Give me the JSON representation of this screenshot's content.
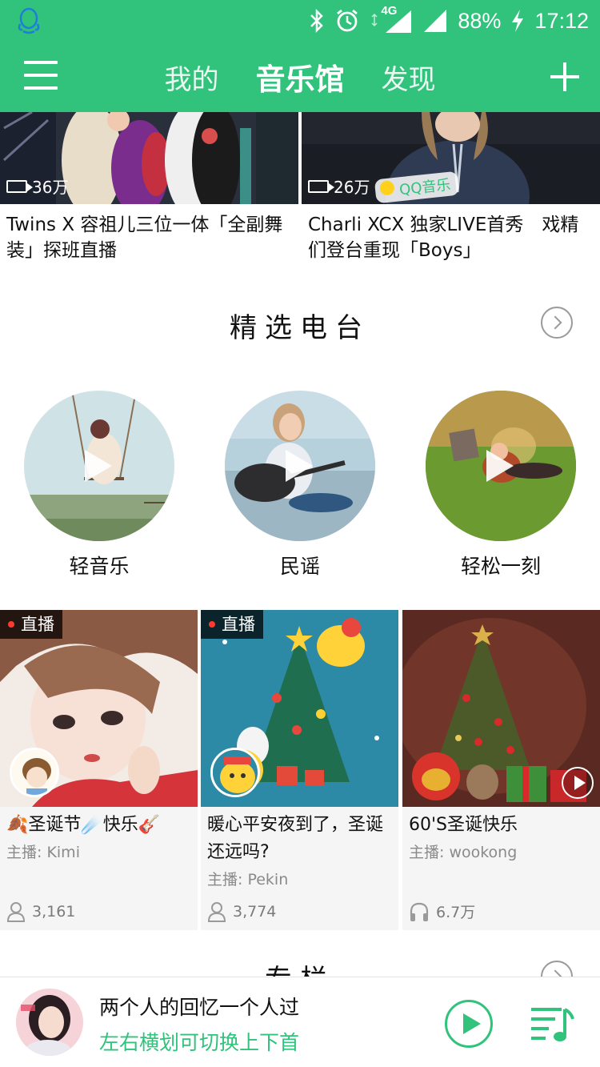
{
  "status_bar": {
    "battery": "88%",
    "time": "17:12",
    "network": "4G"
  },
  "nav": {
    "tabs": [
      {
        "label": "我的",
        "active": false
      },
      {
        "label": "音乐馆",
        "active": true
      },
      {
        "label": "发现",
        "active": false
      }
    ]
  },
  "videos": [
    {
      "views": "36万",
      "title": "Twins X 容祖儿三位一体「全副舞装」探班直播"
    },
    {
      "views": "26万",
      "title": "Charli XCX 独家LIVE首秀　戏精们登台重现「Boys」",
      "watermark": "QQ音乐"
    }
  ],
  "radio_section": {
    "title": "精选电台",
    "stations": [
      {
        "label": "轻音乐"
      },
      {
        "label": "民谣"
      },
      {
        "label": "轻松一刻"
      }
    ]
  },
  "live_cards": [
    {
      "badge": "直播",
      "title": "🍂圣诞节☄️快乐🎸",
      "host": "主播: Kimi",
      "stat": "3,161",
      "stat_icon": "user-icon"
    },
    {
      "badge": "直播",
      "title": "暖心平安夜到了，圣诞还远吗?",
      "host": "主播: Pekin",
      "stat": "3,774",
      "stat_icon": "user-icon"
    },
    {
      "badge": "",
      "title": "60'S圣诞快乐",
      "host": "主播: wookong",
      "stat": "6.7万",
      "stat_icon": "headphones-icon"
    }
  ],
  "next_section": {
    "title": "专栏"
  },
  "player": {
    "song": "两个人的回忆一个人过",
    "hint": "左右横划可切换上下首"
  },
  "colors": {
    "brand_green": "#31c27c"
  }
}
